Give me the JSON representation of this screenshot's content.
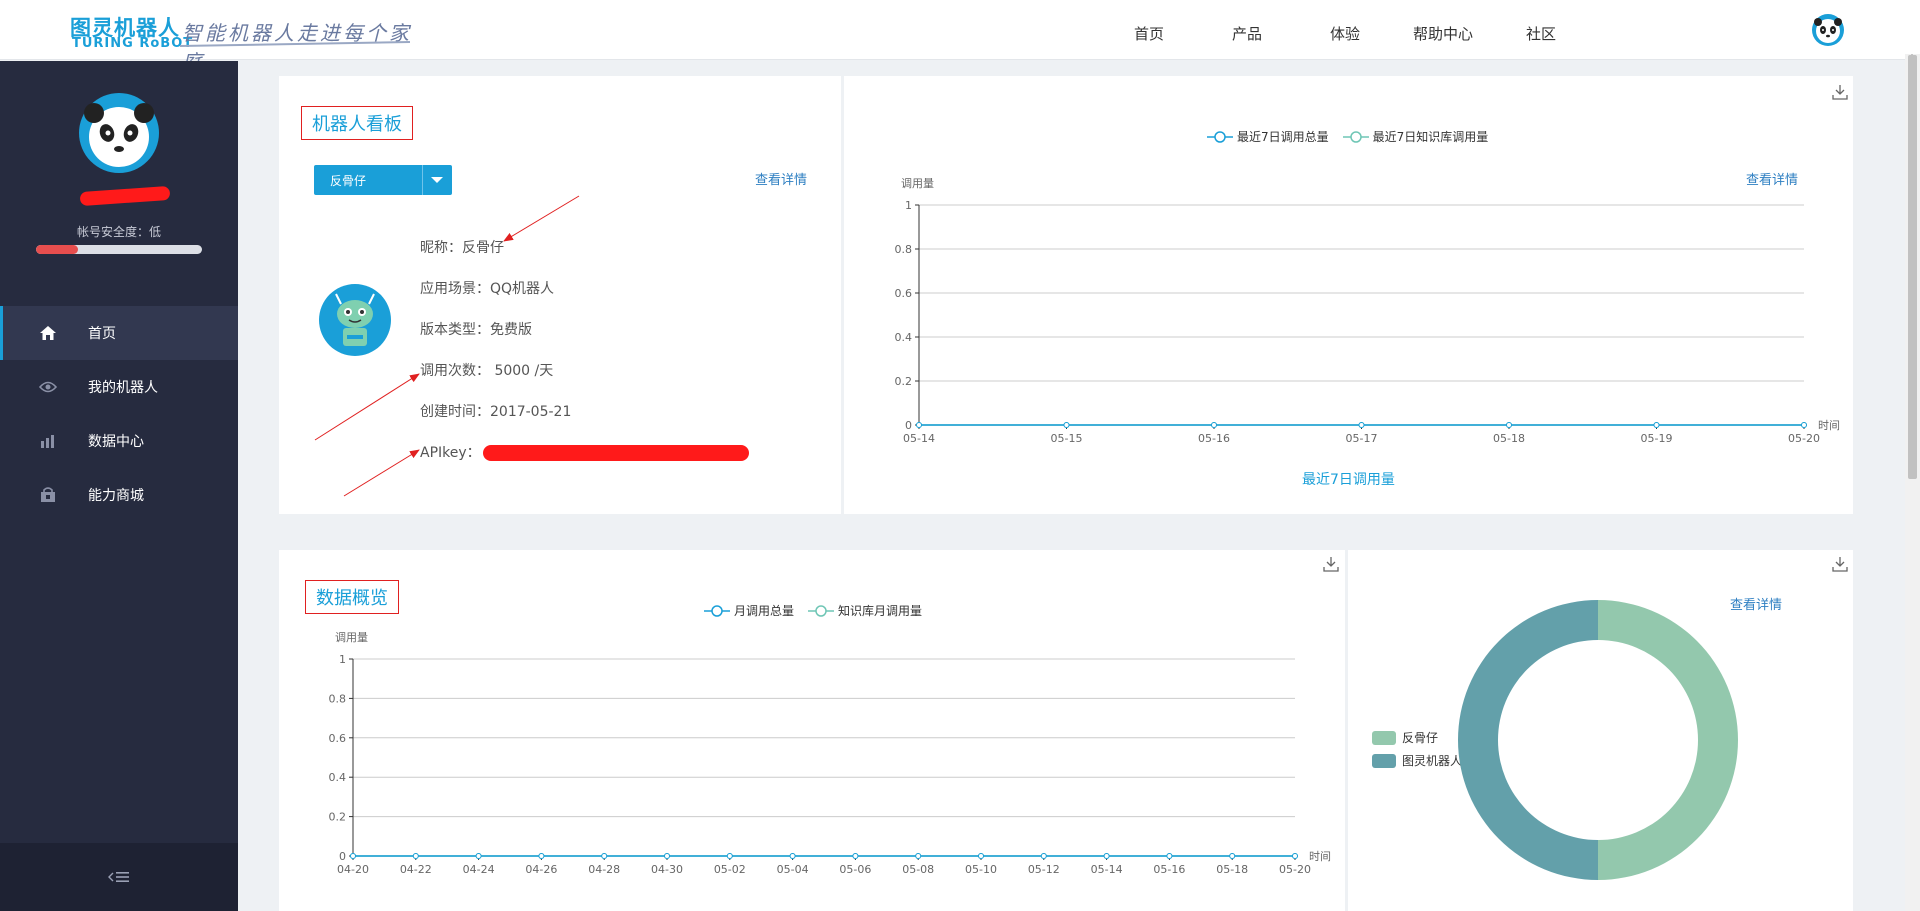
{
  "header": {
    "logo_cn": "图灵机器人",
    "logo_en": "TURING RoBOT",
    "slogan": "智能机器人走进每个家庭",
    "nav": [
      "首页",
      "产品",
      "体验",
      "帮助中心",
      "社区"
    ]
  },
  "sidebar": {
    "security_label": "帐号安全度：低",
    "security_level": 0.25,
    "items": [
      {
        "label": "首页",
        "icon": "home-icon",
        "active": true
      },
      {
        "label": "我的机器人",
        "icon": "eye-icon",
        "active": false
      },
      {
        "label": "数据中心",
        "icon": "bar-chart-icon",
        "active": false
      },
      {
        "label": "能力商城",
        "icon": "shop-icon",
        "active": false
      }
    ]
  },
  "board": {
    "title": "机器人看板",
    "selected_robot": "反骨仔",
    "detail_link": "查看详情",
    "info": [
      "昵称：反骨仔",
      "应用场景：QQ机器人",
      "版本类型：免费版",
      "调用次数： 5000 /天",
      "创建时间：2017-05-21",
      "APIkey："
    ]
  },
  "weekly": {
    "detail_link": "查看详情",
    "caption": "最近7日调用量",
    "chart_data": {
      "type": "line",
      "x": [
        "05-14",
        "05-15",
        "05-16",
        "05-17",
        "05-18",
        "05-19",
        "05-20"
      ],
      "series": [
        {
          "name": "最近7日调用总量",
          "values": [
            0,
            0,
            0,
            0,
            0,
            0,
            0
          ]
        },
        {
          "name": "最近7日知识库调用量",
          "values": [
            0,
            0,
            0,
            0,
            0,
            0,
            0
          ]
        }
      ],
      "ylabel": "调用量",
      "xlabel": "时间",
      "ylim": [
        0,
        1
      ],
      "yticks": [
        "0",
        "0.2",
        "0.4",
        "0.6",
        "0.8",
        "1"
      ],
      "grid": true,
      "legend": "top-center"
    }
  },
  "overview": {
    "title": "数据概览",
    "chart_data": {
      "type": "line",
      "x": [
        "04-20",
        "04-22",
        "04-24",
        "04-26",
        "04-28",
        "04-30",
        "05-02",
        "05-04",
        "05-06",
        "05-08",
        "05-10",
        "05-12",
        "05-14",
        "05-16",
        "05-18",
        "05-20"
      ],
      "series": [
        {
          "name": "月调用总量",
          "values": [
            0,
            0,
            0,
            0,
            0,
            0,
            0,
            0,
            0,
            0,
            0,
            0,
            0,
            0,
            0,
            0
          ]
        },
        {
          "name": "知识库月调用量",
          "values": [
            0,
            0,
            0,
            0,
            0,
            0,
            0,
            0,
            0,
            0,
            0,
            0,
            0,
            0,
            0,
            0
          ]
        }
      ],
      "ylabel": "调用量",
      "xlabel": "时间",
      "ylim": [
        0,
        1
      ],
      "yticks": [
        "0",
        "0.2",
        "0.4",
        "0.6",
        "0.8",
        "1"
      ],
      "grid": true,
      "legend": "top-center"
    }
  },
  "donut": {
    "detail_link": "查看详情",
    "chart_data": {
      "type": "pie",
      "categories": [
        "反骨仔",
        "图灵机器人"
      ],
      "values": [
        50,
        50
      ],
      "colors": [
        "#93c8ad",
        "#63a0aa"
      ]
    }
  },
  "colors": {
    "accent": "#1a9fd8",
    "sidebar": "#262b3f",
    "line_series_1": "#1a9fd8",
    "line_series_2": "#6fc6b5"
  }
}
